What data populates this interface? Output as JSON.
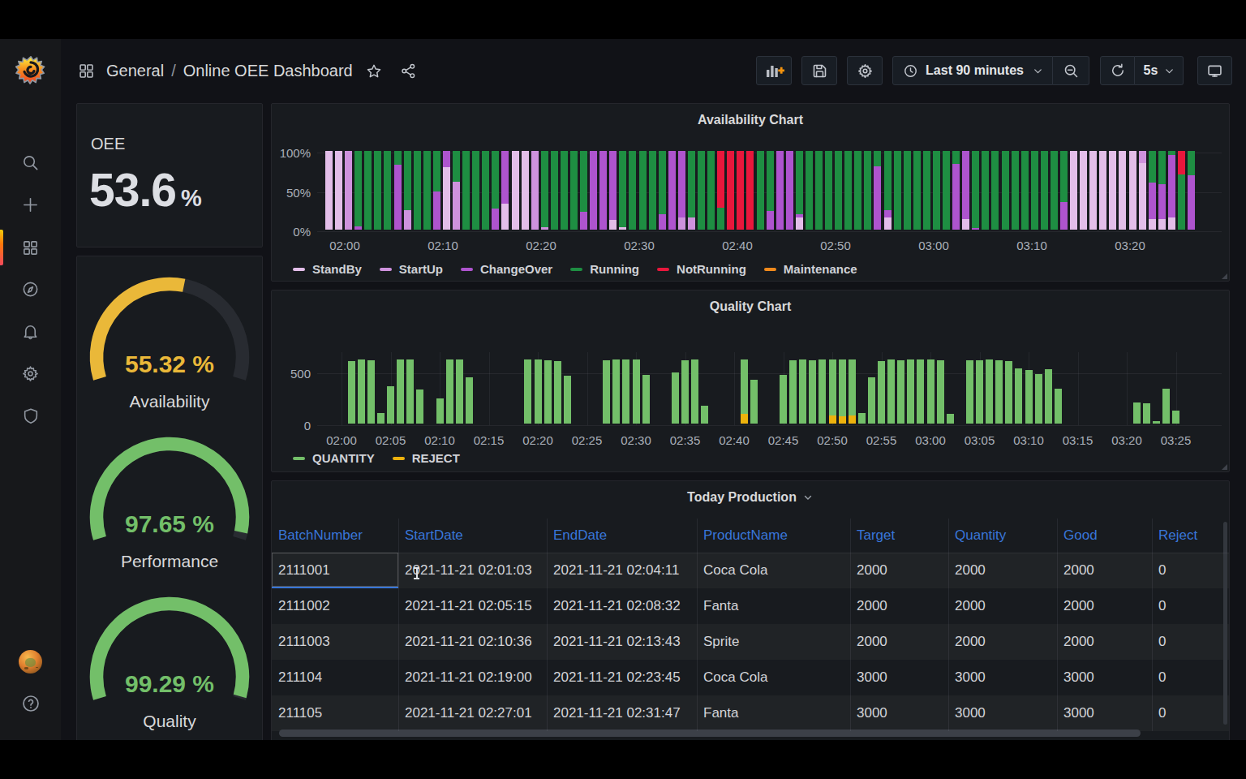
{
  "header": {
    "breadcrumb": {
      "section": "General",
      "separator": "/",
      "title": "Online OEE Dashboard"
    },
    "time_picker": {
      "label": "Last 90 minutes"
    },
    "refresh": {
      "interval": "5s"
    }
  },
  "panels": {
    "oee": {
      "label": "OEE",
      "value": "53.6",
      "unit": "%"
    },
    "gauges": [
      {
        "value": "55.32 %",
        "pct": 55.32,
        "label": "Availability",
        "color": "#EAB839",
        "track": "#282B31"
      },
      {
        "value": "97.65 %",
        "pct": 97.65,
        "label": "Performance",
        "color": "#73BF69",
        "track": "#282B31"
      },
      {
        "value": "99.29 %",
        "pct": 99.29,
        "label": "Quality",
        "color": "#73BF69",
        "track": "#282B31"
      }
    ]
  },
  "chart_data": [
    {
      "id": "availability",
      "type": "bar",
      "stacked": true,
      "title": "Availability Chart",
      "ylabel": "",
      "xlabel": "",
      "ylim": [
        0,
        100
      ],
      "grid": true,
      "legend_position": "bottom",
      "yticks": [
        "100%",
        "50%",
        "0%"
      ],
      "xticks": [
        "02:00",
        "02:10",
        "02:20",
        "02:30",
        "02:40",
        "02:50",
        "03:00",
        "03:10",
        "03:20"
      ],
      "palette": {
        "sb": "#E3BEE9",
        "su": "#CE92DD",
        "co": "#AE54CE",
        "ru": "#1E8E42",
        "nr": "#E8173C",
        "mt": "#F08A1C"
      },
      "legend": [
        {
          "key": "sb",
          "label": "StandBy"
        },
        {
          "key": "su",
          "label": "StartUp"
        },
        {
          "key": "co",
          "label": "ChangeOver"
        },
        {
          "key": "ru",
          "label": "Running"
        },
        {
          "key": "nr",
          "label": "NotRunning"
        },
        {
          "key": "mt",
          "label": "Maintenance"
        }
      ],
      "bars": [
        [
          [
            "sb",
            1
          ]
        ],
        [
          [
            "sb",
            1
          ]
        ],
        [
          [
            "su",
            1
          ]
        ],
        [
          [
            "co",
            0.04
          ],
          [
            "ru",
            0.96
          ]
        ],
        [
          [
            "ru",
            1
          ]
        ],
        [
          [
            "ru",
            1
          ]
        ],
        [
          [
            "ru",
            1
          ]
        ],
        [
          [
            "co",
            0.82
          ],
          [
            "ru",
            0.18
          ]
        ],
        [
          [
            "su",
            0.25
          ],
          [
            "ru",
            0.75
          ]
        ],
        [
          [
            "ru",
            1
          ]
        ],
        [
          [
            "ru",
            1
          ]
        ],
        [
          [
            "co",
            0.48
          ],
          [
            "ru",
            0.52
          ]
        ],
        [
          [
            "sb",
            0.79
          ],
          [
            "co",
            0.21
          ]
        ],
        [
          [
            "su",
            0.61
          ],
          [
            "ru",
            0.39
          ]
        ],
        [
          [
            "ru",
            1
          ]
        ],
        [
          [
            "ru",
            1
          ]
        ],
        [
          [
            "ru",
            1
          ]
        ],
        [
          [
            "co",
            0.27
          ],
          [
            "ru",
            0.73
          ]
        ],
        [
          [
            "sb",
            0.33
          ],
          [
            "co",
            0.67
          ]
        ],
        [
          [
            "sb",
            1
          ]
        ],
        [
          [
            "sb",
            1
          ]
        ],
        [
          [
            "su",
            1
          ]
        ],
        [
          [
            "su",
            0.03
          ],
          [
            "ru",
            0.97
          ]
        ],
        [
          [
            "ru",
            1
          ]
        ],
        [
          [
            "ru",
            1
          ]
        ],
        [
          [
            "ru",
            1
          ]
        ],
        [
          [
            "co",
            0.23
          ],
          [
            "ru",
            0.77
          ]
        ],
        [
          [
            "co",
            1
          ]
        ],
        [
          [
            "co",
            1
          ]
        ],
        [
          [
            "sb",
            0.12
          ],
          [
            "co",
            0.88
          ]
        ],
        [
          [
            "sb",
            0.03
          ],
          [
            "ru",
            0.97
          ]
        ],
        [
          [
            "ru",
            1
          ]
        ],
        [
          [
            "ru",
            1
          ]
        ],
        [
          [
            "ru",
            1
          ]
        ],
        [
          [
            "co",
            0.2
          ],
          [
            "ru",
            0.8
          ]
        ],
        [
          [
            "co",
            1
          ]
        ],
        [
          [
            "su",
            0.15
          ],
          [
            "co",
            0.85
          ]
        ],
        [
          [
            "su",
            0.15
          ],
          [
            "ru",
            0.85
          ]
        ],
        [
          [
            "ru",
            1
          ]
        ],
        [
          [
            "ru",
            1
          ]
        ],
        [
          [
            "ru",
            0.28
          ],
          [
            "nr",
            0.72
          ]
        ],
        [
          [
            "nr",
            1
          ]
        ],
        [
          [
            "nr",
            1
          ]
        ],
        [
          [
            "nr",
            1
          ]
        ],
        [
          [
            "ru",
            1
          ]
        ],
        [
          [
            "co",
            0.24
          ],
          [
            "ru",
            0.76
          ]
        ],
        [
          [
            "co",
            1
          ]
        ],
        [
          [
            "co",
            1
          ]
        ],
        [
          [
            "sb",
            0.15
          ],
          [
            "co",
            0.05
          ],
          [
            "ru",
            0.8
          ]
        ],
        [
          [
            "ru",
            1
          ]
        ],
        [
          [
            "ru",
            1
          ]
        ],
        [
          [
            "ru",
            1
          ]
        ],
        [
          [
            "ru",
            1
          ]
        ],
        [
          [
            "ru",
            1
          ]
        ],
        [
          [
            "ru",
            1
          ]
        ],
        [
          [
            "ru",
            1
          ]
        ],
        [
          [
            "co",
            0.8
          ],
          [
            "ru",
            0.2
          ]
        ],
        [
          [
            "sb",
            0.15
          ],
          [
            "co",
            0.1
          ],
          [
            "ru",
            0.75
          ]
        ],
        [
          [
            "ru",
            1
          ]
        ],
        [
          [
            "ru",
            1
          ]
        ],
        [
          [
            "ru",
            1
          ]
        ],
        [
          [
            "ru",
            1
          ]
        ],
        [
          [
            "ru",
            1
          ]
        ],
        [
          [
            "ru",
            1
          ]
        ],
        [
          [
            "co",
            0.84
          ],
          [
            "ru",
            0.16
          ]
        ],
        [
          [
            "sb",
            0.13
          ],
          [
            "co",
            0.87
          ]
        ],
        [
          [
            "co",
            0.02
          ],
          [
            "ru",
            0.98
          ]
        ],
        [
          [
            "ru",
            1
          ]
        ],
        [
          [
            "ru",
            1
          ]
        ],
        [
          [
            "ru",
            1
          ]
        ],
        [
          [
            "ru",
            1
          ]
        ],
        [
          [
            "ru",
            1
          ]
        ],
        [
          [
            "ru",
            1
          ]
        ],
        [
          [
            "ru",
            1
          ]
        ],
        [
          [
            "ru",
            1
          ]
        ],
        [
          [
            "co",
            0.35
          ],
          [
            "ru",
            0.65
          ]
        ],
        [
          [
            "sb",
            1
          ]
        ],
        [
          [
            "sb",
            1
          ]
        ],
        [
          [
            "sb",
            1
          ]
        ],
        [
          [
            "sb",
            1
          ]
        ],
        [
          [
            "sb",
            1
          ]
        ],
        [
          [
            "sb",
            1
          ]
        ],
        [
          [
            "sb",
            1
          ]
        ],
        [
          [
            "sb",
            0.85
          ],
          [
            "su",
            0.15
          ]
        ],
        [
          [
            "sb",
            0.13
          ],
          [
            "co",
            0.47
          ],
          [
            "ru",
            0.4
          ]
        ],
        [
          [
            "sb",
            0.13
          ],
          [
            "co",
            0.45
          ],
          [
            "ru",
            0.42
          ]
        ],
        [
          [
            "sb",
            0.15
          ],
          [
            "co",
            0.8
          ],
          [
            "ru",
            0.05
          ]
        ],
        [
          [
            "ru",
            0.7
          ],
          [
            "nr",
            0.3
          ]
        ],
        [
          [
            "co",
            0.69
          ],
          [
            "ru",
            0.31
          ]
        ]
      ]
    },
    {
      "id": "quality",
      "type": "bar",
      "stacked": false,
      "title": "Quality Chart",
      "ylabel": "",
      "xlabel": "",
      "ylim": [
        0,
        650
      ],
      "grid": true,
      "legend_position": "bottom",
      "yticks": [
        "500",
        "0"
      ],
      "xticks": [
        "02:00",
        "02:05",
        "02:10",
        "02:15",
        "02:20",
        "02:25",
        "02:30",
        "02:35",
        "02:40",
        "02:45",
        "02:50",
        "02:55",
        "03:00",
        "03:05",
        "03:10",
        "03:15",
        "03:20",
        "03:25"
      ],
      "palette": {
        "q": "#73BF69",
        "r": "#EDB20D"
      },
      "legend": [
        {
          "key": "q",
          "label": "QUANTITY"
        },
        {
          "key": "r",
          "label": "REJECT"
        }
      ],
      "bars": [
        [
          1,
          600,
          0
        ],
        [
          2,
          615,
          0
        ],
        [
          3,
          610,
          0
        ],
        [
          4,
          100,
          0
        ],
        [
          5,
          360,
          0
        ],
        [
          6,
          617,
          0
        ],
        [
          7,
          617,
          0
        ],
        [
          8,
          325,
          0
        ],
        [
          10,
          240,
          0
        ],
        [
          11,
          617,
          0
        ],
        [
          12,
          617,
          0
        ],
        [
          13,
          445,
          0
        ],
        [
          19,
          617,
          0
        ],
        [
          20,
          617,
          0
        ],
        [
          21,
          610,
          0
        ],
        [
          22,
          605,
          0
        ],
        [
          23,
          460,
          0
        ],
        [
          27,
          610,
          0
        ],
        [
          28,
          617,
          0
        ],
        [
          29,
          617,
          0
        ],
        [
          30,
          617,
          0
        ],
        [
          31,
          465,
          0
        ],
        [
          34,
          495,
          0
        ],
        [
          35,
          610,
          0
        ],
        [
          36,
          617,
          0
        ],
        [
          37,
          170,
          0
        ],
        [
          41,
          615,
          90
        ],
        [
          42,
          420,
          0
        ],
        [
          45,
          465,
          0
        ],
        [
          46,
          610,
          0
        ],
        [
          47,
          617,
          0
        ],
        [
          48,
          612,
          0
        ],
        [
          49,
          617,
          0
        ],
        [
          50,
          615,
          75
        ],
        [
          51,
          617,
          70
        ],
        [
          52,
          617,
          80
        ],
        [
          53,
          100,
          0
        ],
        [
          54,
          445,
          0
        ],
        [
          55,
          605,
          0
        ],
        [
          56,
          620,
          0
        ],
        [
          57,
          612,
          0
        ],
        [
          58,
          617,
          0
        ],
        [
          59,
          615,
          0
        ],
        [
          60,
          620,
          0
        ],
        [
          61,
          610,
          0
        ],
        [
          62,
          90,
          0
        ],
        [
          64,
          613,
          0
        ],
        [
          65,
          610,
          0
        ],
        [
          66,
          617,
          0
        ],
        [
          67,
          613,
          0
        ],
        [
          68,
          601,
          0
        ],
        [
          69,
          534,
          0
        ],
        [
          70,
          519,
          0
        ],
        [
          71,
          478,
          0
        ],
        [
          72,
          527,
          0
        ],
        [
          73,
          334,
          0
        ],
        [
          81,
          202,
          0
        ],
        [
          82,
          196,
          0
        ],
        [
          83,
          25,
          0
        ],
        [
          84,
          334,
          0
        ],
        [
          85,
          125,
          0
        ]
      ]
    },
    {
      "id": "production",
      "type": "table",
      "title": "Today Production",
      "columns": [
        "BatchNumber",
        "StartDate",
        "EndDate",
        "ProductName",
        "Target",
        "Quantity",
        "Good",
        "Reject"
      ],
      "rows": [
        [
          "2111001",
          "2021-11-21 02:01:03",
          "2021-11-21 02:04:11",
          "Coca Cola",
          "2000",
          "2000",
          "2000",
          "0"
        ],
        [
          "2111002",
          "2021-11-21 02:05:15",
          "2021-11-21 02:08:32",
          "Fanta",
          "2000",
          "2000",
          "2000",
          "0"
        ],
        [
          "2111003",
          "2021-11-21 02:10:36",
          "2021-11-21 02:13:43",
          "Sprite",
          "2000",
          "2000",
          "2000",
          "0"
        ],
        [
          "211104",
          "2021-11-21 02:19:00",
          "2021-11-21 02:23:45",
          "Coca Cola",
          "3000",
          "3000",
          "3000",
          "0"
        ],
        [
          "211105",
          "2021-11-21 02:27:01",
          "2021-11-21 02:31:47",
          "Fanta",
          "3000",
          "3000",
          "3000",
          "0"
        ]
      ]
    }
  ]
}
